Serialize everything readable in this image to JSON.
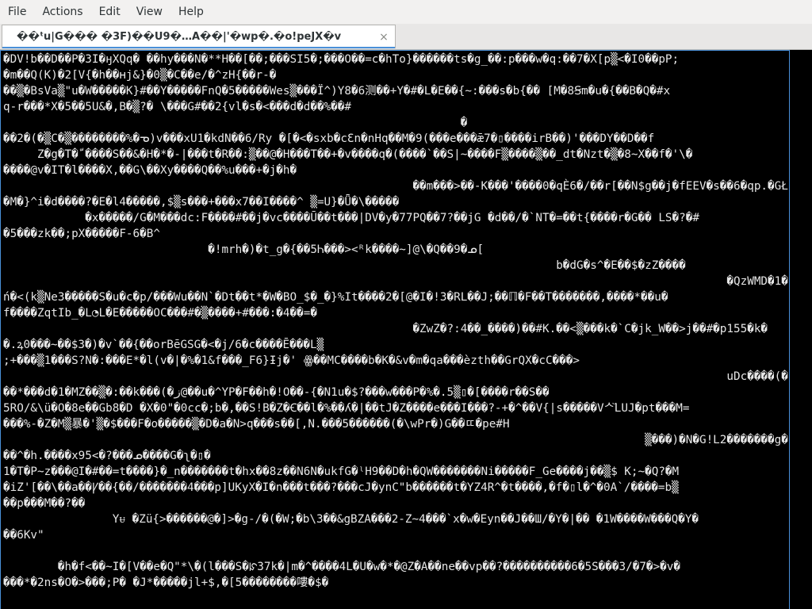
{
  "menubar": {
    "items": [
      "File",
      "Actions",
      "Edit",
      "View",
      "Help"
    ]
  },
  "tab": {
    "title": "��ᵗu|G��� �3F)��U9�…A��|'�wp�.�o!peJX�v",
    "close_glyph": "×"
  },
  "terminal": {
    "lines": [
      "�DV!b��D��P�3I�ӈXQq� ��hy���N�**H��[��;���SI5�;���O��=c�hTo}������ts�g_��:p���w�q:��7�X[p▒<�I0��pP;",
      "�m��Q(K)�2[V{�h��ʜj&}�0▒�C��e/�^zH{��r-�",
      "��▒�BsVa▒\"u�W�����K}#��Y�����FnQ�5�����Wes▒���Ï^)Y8�6测��+Y�#�L�E��{~:���s�b{�� [M�8Ꞩm�u�{��B�Q�#x",
      "q-r���*X�5��5U&�,B�▒?� \\���G#��2{vl�s�<���d�d��%��#",
      "                                                                   �",
      "��2�(�▒C�▒��������%�ᓀ)v���xU1�kdN��6/Ry �[�<�sxb�cƐn�nHqَ��M�9(���e���ǣ7�▯����irB��)'���DY��D��f",
      "     Z�g�T�ﹼ����S��&�H�*�-|���t�R��:▒��@�H���T��+�v����q�(����`��S|~����F▒����▒��_dt�Nzt�▒�8~X��f�'\\�",
      "����@v�IT�l����X,��G\\��Xy����Q��%u���+�j�h�",
      "                                                            ��m���>��-K���'����0�qÈ6�/��r[��N$g��j�fEEV�s��6�qp.�GŁ%",
      "�M�}^i�d����?�E�l4�����,$▒s���+���x7��I����^ ▒=U}�Ǖ�\\�����",
      "            �x�����/G�M���dc:F����#��j�vc����Ū��t���|DV�y�77PQ��7?��jG �d��/�`NT�=��t{����r�G�� LS�?�#",
      "�5���zk��;pX�����F-6�B^",
      "                              �!mrh�)�t_g�{��5Ꮒ���><ᴿk����~]@\\�Q��9�ᓄ[",
      "                                                                                 b�dG�s^�E��$�zZ����",
      "                                                                                                          �QzWMD�1����{�o�",
      "ń�<(k▒Ne3�����S�u�c�p/���Wu��N`�Dt��t*�W�BO_$�_�}%It����2�[@�I�!3�RL��J;��ℿ�F��T�������,����*��u�",
      "f����ZqtIb_�L◔L�E�����OC���#�▒����+#���:�4��=�",
      "                                                            �ZwZ�?:4��_����)��#K.��<▒���k�`C�jk_W��>j��#�p155�k�",
      "�.ꝝ0���~��$3�)�v`��{��orBēGSG�<�j/6�c����Ē���L▒",
      ";+���▒1���S?N�:���E*�l(v�|�%�1&f���_F6}Ɨj�' ꙮ��MC����b�K�&v�m�qa���èzth��GrQX�cC���>",
      "                                                                                                          uDc����(��V�kpt�2",
      "��*���d�1�MZ��▒�:��k���(�ز@��u�^YP�F��h�!O��-{�N1u�$?���w���P�%�.5▒▯�[����r��S��",
      "5RO/&\\ü�O�8e��Gb8�D �X�0\"�0cc�;b�,��S!B�Z�Ꞓ��l�%��ʎ�|��tJ�Z����e���I���?-+�^��V{|s�����Vᄉ꙼LUJ�pt���M=",
      "���%-�Z�M▒暴�'▒�$���F�o�����▒�D�a�N>q���s��[,N.���5������(�\\wPr�)G��ﾨ�pe#H",
      "                                                                                              ▒���)�N�G!L2�������g��_+ꞎ�",
      "��^�h.����x95<�?���ᓄ����G�ʅ�▯�",
      "1�T�P~z���@I�#��=t����}�_n�������t�hx��8z��N6N�ukfG�ˡH9��D�h�QW�������Ni�����F_Ge����j��▒$ K;~�Q?�M",
      "�iZ'[��\\��a��Ꝩ��{��/�������4���p]UKyX�I�n���t���?���cJ�ynC\"b������t�YZ4R^�t����,�f�▯l�^�0A`/����=b▒",
      "��p���M��?��",
      "                Yᵾ �Zü{>������@�]>�g-/�(�W;�b\\3��&gBZA���2-Z~4���`x�w�Eyn��J��Ш/�Y�|�� �1W����W���Q�Y�",
      "��6Kv\"",
      "",
      "        �h�f<��~I�[V��e�Q\"*\\�(l���S�ꡯ37k�|m�^����4L�U�w�*�@Z�A��ne��vp��?����������6�5S���3/�7�>�v�",
      "���*�2ns�O�>���;P� �J*�����jl+$,�[5��������嘍�$�"
    ]
  }
}
